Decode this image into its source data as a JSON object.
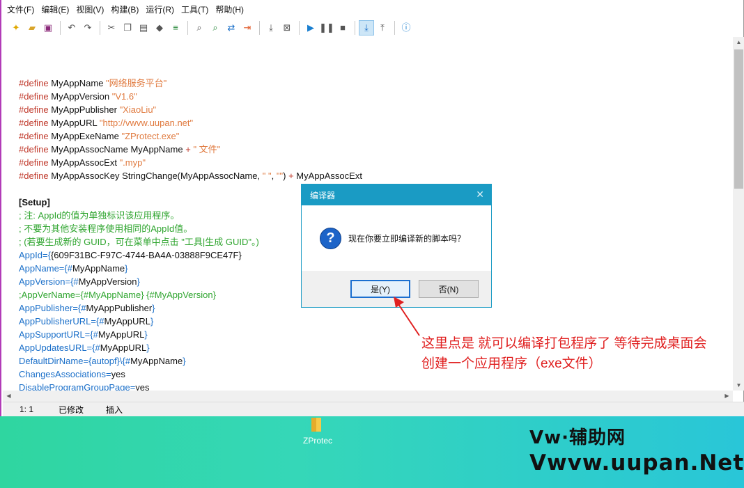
{
  "menu": [
    "文件(F)",
    "编辑(E)",
    "视图(V)",
    "构建(B)",
    "运行(R)",
    "工具(T)",
    "帮助(H)"
  ],
  "code": {
    "defines": [
      {
        "kw": "#define",
        "name": "MyAppName",
        "val": "\"网络服务平台\""
      },
      {
        "kw": "#define",
        "name": "MyAppVersion",
        "val": "\"V1.6\""
      },
      {
        "kw": "#define",
        "name": "MyAppPublisher",
        "val": "\"XiaoLiu\""
      },
      {
        "kw": "#define",
        "name": "MyAppURL",
        "val": "\"http://vwvw.uupan.net\""
      },
      {
        "kw": "#define",
        "name": "MyAppExeName",
        "val": "\"ZProtect.exe\""
      }
    ],
    "assoc_name": {
      "kw": "#define",
      "name": "MyAppAssocName",
      "ref": "MyAppName",
      "op": "+",
      "val": "\" 文件\""
    },
    "assoc_ext": {
      "kw": "#define",
      "name": "MyAppAssocExt",
      "val": "\".myp\""
    },
    "assoc_key": {
      "kw": "#define",
      "name": "MyAppAssocKey",
      "func": "StringChange(MyAppAssocName,",
      "s1": "\" \"",
      "comma": ",",
      "s2": "\"\"",
      "close": ")",
      "op": "+",
      "ref": "MyAppAssocExt"
    },
    "section": "[Setup]",
    "comments": [
      "; 注: AppId的值为单独标识该应用程序。",
      "; 不要为其他安装程序使用相同的AppId值。",
      "; (若要生成新的 GUID，可在菜单中点击 \"工具|生成 GUID\"。)"
    ],
    "settings": [
      {
        "key": "AppId={",
        "val": "{609F31BC-F97C-4744-BA4A-03888F9CE47F}"
      },
      {
        "key": "AppName={#",
        "val": "MyAppName",
        "end": "}"
      },
      {
        "key": "AppVersion={#",
        "val": "MyAppVersion",
        "end": "}"
      }
    ],
    "verline": ";AppVerName={#MyAppName} {#MyAppVersion}",
    "settings2": [
      {
        "key": "AppPublisher={#",
        "val": "MyAppPublisher",
        "end": "}"
      },
      {
        "key": "AppPublisherURL={#",
        "val": "MyAppURL",
        "end": "}"
      },
      {
        "key": "AppSupportURL={#",
        "val": "MyAppURL",
        "end": "}"
      },
      {
        "key": "AppUpdatesURL={#",
        "val": "MyAppURL",
        "end": "}"
      }
    ],
    "dirline": {
      "key": "DefaultDirName={autopf}\\{#",
      "val": "MyAppName",
      "end": "}"
    },
    "changes": {
      "key": "ChangesAssociations=",
      "val": "yes"
    },
    "disable": {
      "key": "DisableProgramGroupPage=",
      "val": "yes"
    }
  },
  "status": {
    "pos": "1:   1",
    "modified": "已修改",
    "mode": "插入"
  },
  "dialog": {
    "title": "编译器",
    "message": "现在你要立即编译新的脚本吗？",
    "yes": "是(Y)",
    "no": "否(N)"
  },
  "annotation": {
    "line1": "这里点是 就可以编译打包程序了 等待完成桌面会",
    "line2": "创建一个应用程序（exe文件）"
  },
  "desktop": {
    "folder_label": "ZProtec"
  },
  "watermark": {
    "line1": "Vw·辅助网",
    "line2": "Vwvw.uupan.Net"
  },
  "colors": {
    "titlebar": "#1a9bc4",
    "annotation": "#e02020",
    "keyword": "#c0392b",
    "string": "#e07a3f",
    "comment": "#2fa52f",
    "key": "#1a6fc9"
  }
}
